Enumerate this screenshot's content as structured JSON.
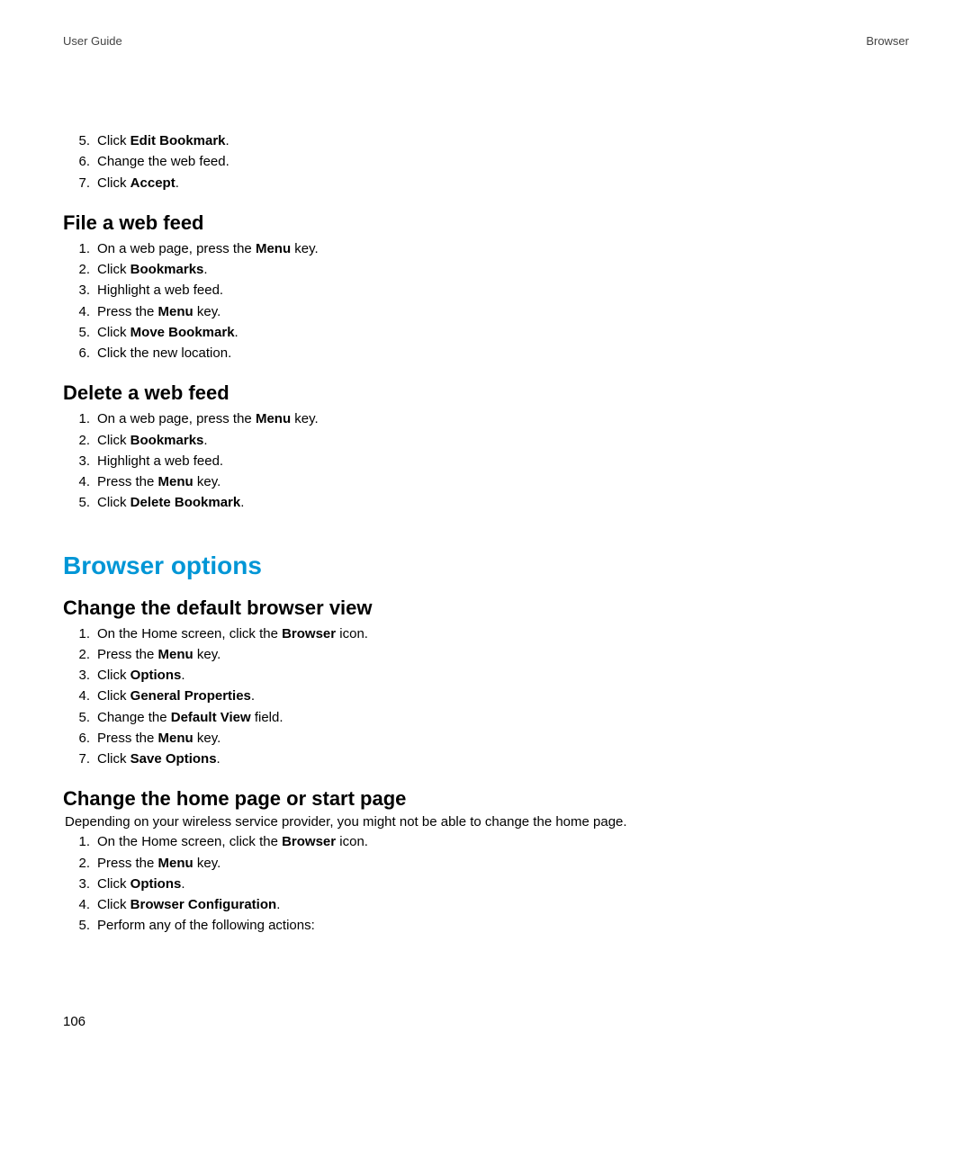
{
  "header": {
    "left": "User Guide",
    "right": "Browser"
  },
  "pageNumber": "106",
  "topSteps": {
    "start": 5,
    "items": [
      {
        "pre": "Click ",
        "bold": "Edit Bookmark",
        "post": "."
      },
      {
        "pre": "Change the web feed.",
        "bold": "",
        "post": ""
      },
      {
        "pre": "Click ",
        "bold": "Accept",
        "post": "."
      }
    ]
  },
  "sections": [
    {
      "heading": "File a web feed",
      "steps": [
        {
          "pre": "On a web page, press the ",
          "bold": "Menu",
          "post": " key."
        },
        {
          "pre": "Click ",
          "bold": "Bookmarks",
          "post": "."
        },
        {
          "pre": "Highlight a web feed.",
          "bold": "",
          "post": ""
        },
        {
          "pre": "Press the ",
          "bold": "Menu",
          "post": " key."
        },
        {
          "pre": "Click ",
          "bold": "Move Bookmark",
          "post": "."
        },
        {
          "pre": "Click the new location.",
          "bold": "",
          "post": ""
        }
      ]
    },
    {
      "heading": "Delete a web feed",
      "steps": [
        {
          "pre": "On a web page, press the ",
          "bold": "Menu",
          "post": " key."
        },
        {
          "pre": "Click ",
          "bold": "Bookmarks",
          "post": "."
        },
        {
          "pre": "Highlight a web feed.",
          "bold": "",
          "post": ""
        },
        {
          "pre": "Press the ",
          "bold": "Menu",
          "post": " key."
        },
        {
          "pre": "Click ",
          "bold": "Delete Bookmark",
          "post": "."
        }
      ]
    }
  ],
  "majorHeading": "Browser options",
  "sections2": [
    {
      "heading": "Change the default browser view",
      "steps": [
        {
          "pre": "On the Home screen, click the ",
          "bold": "Browser",
          "post": " icon."
        },
        {
          "pre": "Press the ",
          "bold": "Menu",
          "post": " key."
        },
        {
          "pre": "Click ",
          "bold": "Options",
          "post": "."
        },
        {
          "pre": "Click ",
          "bold": "General Properties",
          "post": "."
        },
        {
          "pre": "Change the ",
          "bold": "Default View",
          "post": " field."
        },
        {
          "pre": "Press the ",
          "bold": "Menu",
          "post": " key."
        },
        {
          "pre": "Click ",
          "bold": "Save Options",
          "post": "."
        }
      ]
    },
    {
      "heading": "Change the home page or start page",
      "intro": "Depending on your wireless service provider, you might not be able to change the home page.",
      "steps": [
        {
          "pre": "On the Home screen, click the ",
          "bold": "Browser",
          "post": " icon."
        },
        {
          "pre": "Press the ",
          "bold": "Menu",
          "post": " key."
        },
        {
          "pre": "Click ",
          "bold": "Options",
          "post": "."
        },
        {
          "pre": "Click ",
          "bold": "Browser Configuration",
          "post": "."
        },
        {
          "pre": "Perform any of the following actions:",
          "bold": "",
          "post": ""
        }
      ]
    }
  ]
}
